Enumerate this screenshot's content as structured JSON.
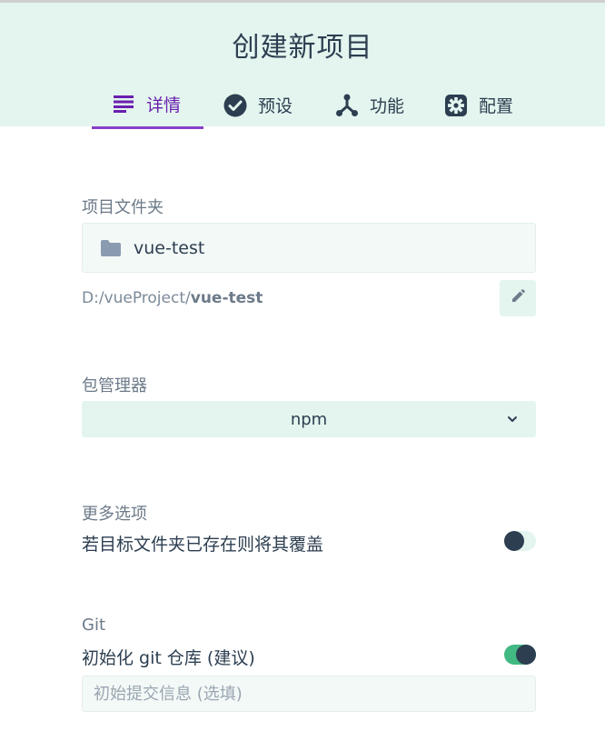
{
  "header": {
    "title": "创建新项目",
    "tabs": [
      {
        "label": "详情",
        "icon": "list-icon",
        "active": true
      },
      {
        "label": "预设",
        "icon": "check-circle-icon",
        "active": false
      },
      {
        "label": "功能",
        "icon": "fork-icon",
        "active": false
      },
      {
        "label": "配置",
        "icon": "gear-icon",
        "active": false
      }
    ]
  },
  "folder": {
    "label": "项目文件夹",
    "value": "vue-test",
    "path_prefix": "D:/vueProject/",
    "path_name": "vue-test",
    "icon": "folder-icon",
    "edit_icon": "pencil-icon"
  },
  "package_manager": {
    "label": "包管理器",
    "value": "npm",
    "icon": "chevron-down-icon"
  },
  "more_options": {
    "label": "更多选项",
    "overwrite_label": "若目标文件夹已存在则将其覆盖",
    "overwrite_enabled": false
  },
  "git": {
    "label": "Git",
    "init_label": "初始化 git 仓库 (建议)",
    "init_enabled": true,
    "commit_value": "",
    "commit_placeholder": "初始提交信息 (选填)"
  },
  "colors": {
    "accent": "#8b3fc9",
    "header_bg": "#e4f5ef",
    "toggle_on": "#42b983",
    "text_dark": "#2c3e50"
  }
}
